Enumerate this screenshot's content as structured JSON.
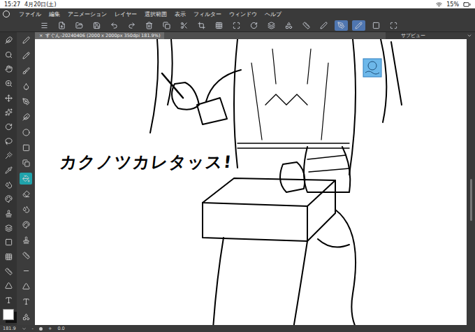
{
  "status_bar": {
    "time": "15:27",
    "date": "4月20日(土)",
    "battery": "15%"
  },
  "menu": [
    "ファイル",
    "編集",
    "アニメーション",
    "レイヤー",
    "選択範囲",
    "表示",
    "フィルター",
    "ウィンドウ",
    "ヘルプ"
  ],
  "command_buttons": [
    {
      "selected": false
    },
    {
      "selected": false
    },
    {
      "selected": false
    },
    {
      "selected": false
    },
    {
      "selected": false
    },
    {
      "selected": false
    },
    {
      "selected": false
    },
    {
      "selected": false
    },
    {
      "selected": false
    },
    {
      "selected": false
    },
    {
      "selected": false
    },
    {
      "selected": false
    },
    {
      "selected": false
    },
    {
      "selected": false
    },
    {
      "selected": false
    },
    {
      "selected": false
    },
    {
      "selected": false
    },
    {
      "selected": true
    },
    {
      "selected": true
    },
    {
      "selected": false
    },
    {
      "selected": false
    }
  ],
  "document_tab": {
    "close": "×",
    "title": "すぐん-20240406 (2000 x 2000px 350dpi 181.9%)"
  },
  "sub_view": {
    "title": "サブビュー"
  },
  "side_tools": [
    {
      "selected": false
    },
    {
      "selected": false
    },
    {
      "selected": false
    },
    {
      "selected": false
    },
    {
      "selected": false
    },
    {
      "selected": false
    },
    {
      "selected": false
    },
    {
      "selected": false
    },
    {
      "selected": false
    },
    {
      "selected": false
    },
    {
      "selected": false
    },
    {
      "selected": false
    },
    {
      "selected": false
    },
    {
      "selected": false
    },
    {
      "selected": false
    },
    {
      "selected": false
    },
    {
      "selected": false
    },
    {
      "selected": false
    },
    {
      "selected": false
    }
  ],
  "tools": [
    {
      "selected": false
    },
    {
      "selected": false
    },
    {
      "selected": false
    },
    {
      "selected": false
    },
    {
      "selected": false
    },
    {
      "selected": false
    },
    {
      "selected": false
    },
    {
      "selected": false
    },
    {
      "selected": false
    },
    {
      "selected": true
    },
    {
      "selected": false
    },
    {
      "selected": false
    },
    {
      "selected": false
    },
    {
      "selected": false
    },
    {
      "selected": false
    },
    {
      "selected": false
    },
    {
      "selected": false
    },
    {
      "selected": false
    },
    {
      "selected": false
    }
  ],
  "canvas": {
    "caption": "カクノツカレタッス!"
  },
  "footer": {
    "zoom": "181.9",
    "zoom_out": "-",
    "zoom_in": "+",
    "rotation": "0.0"
  }
}
